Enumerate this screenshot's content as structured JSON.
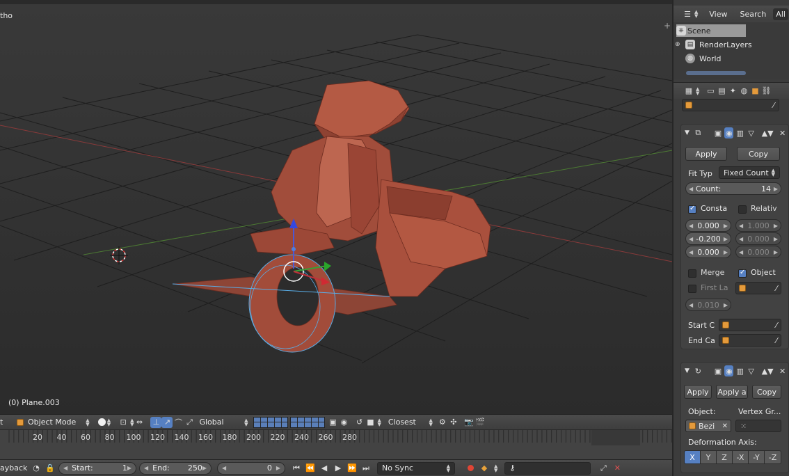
{
  "viewport": {
    "view_label": "tho",
    "object_label": "(0) Plane.003",
    "plus_icon": "plus-icon"
  },
  "vp_header": {
    "menu_partial": "t",
    "mode": "Object Mode",
    "orientation": "Global",
    "snap_target": "Closest"
  },
  "timeline": {
    "ticks": [
      "20",
      "40",
      "60",
      "80",
      "100",
      "120",
      "140",
      "160",
      "180",
      "200",
      "220",
      "240",
      "260",
      "280"
    ]
  },
  "tl_header": {
    "playback_partial": "ayback",
    "start_label": "Start:",
    "start_value": "1",
    "end_label": "End:",
    "end_value": "250",
    "current_frame": "0",
    "sync": "No Sync"
  },
  "outliner": {
    "menu": [
      "View",
      "Search",
      "All"
    ],
    "items": [
      {
        "label": "Scene"
      },
      {
        "label": "RenderLayers"
      },
      {
        "label": "World"
      }
    ]
  },
  "modifier_array": {
    "apply": "Apply",
    "copy": "Copy",
    "fit_type_label": "Fit Typ",
    "fit_type_value": "Fixed Count",
    "count_label": "Count:",
    "count_value": "14",
    "constant_label": "Consta",
    "relative_label": "Relativ",
    "constant_offsets": [
      "0.000",
      "-0.200",
      "0.000"
    ],
    "relative_offsets": [
      "1.000",
      "0.000",
      "0.000"
    ],
    "merge_label": "Merge",
    "object_label": "Object",
    "first_last_label": "First La",
    "merge_distance": "0.010",
    "start_cap_label": "Start C",
    "end_cap_label": "End Ca"
  },
  "modifier_curve": {
    "apply": "Apply",
    "apply_as": "Apply a",
    "copy": "Copy",
    "object_label": "Object:",
    "vertex_group_label": "Vertex Gr...",
    "object_value": "Bezi",
    "deform_axis_label": "Deformation Axis:",
    "axes": [
      "X",
      "Y",
      "Z",
      "-X",
      "-Y",
      "-Z"
    ],
    "active_axis": "X"
  },
  "colors": {
    "accent": "#5680c2",
    "mesh": "#a9503d",
    "object_orange": "#e49a3b"
  }
}
